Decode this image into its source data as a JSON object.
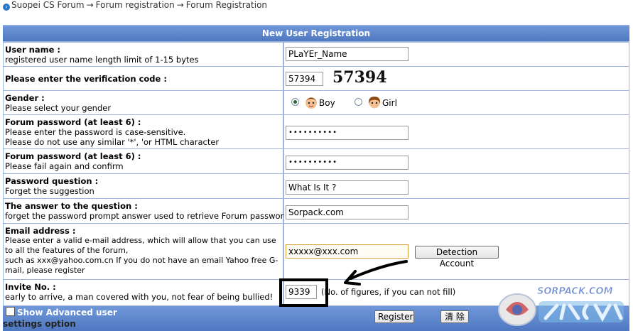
{
  "breadcrumb": {
    "items": [
      "Suopei CS Forum",
      "Forum registration",
      "Forum Registration"
    ],
    "separator": "→"
  },
  "form": {
    "title": "New User Registration",
    "username": {
      "label": "User name :",
      "hint": "registered user name length limit of 1-15 bytes",
      "value": "PLaYEr_Name"
    },
    "verify": {
      "label": "Please enter the verification code :",
      "value": "57394",
      "captcha_text": "57394"
    },
    "gender": {
      "label": "Gender :",
      "hint": "Please select your gender",
      "options": [
        "Boy",
        "Girl"
      ],
      "selected": "Boy"
    },
    "password": {
      "label": "Forum password (at least 6) :",
      "hint1": "Please enter the password is case-sensitive.",
      "hint2": "Please do not use any similar '*', 'or HTML character",
      "value": "••••••••••"
    },
    "password_confirm": {
      "label": "Forum password (at least 6) :",
      "hint": "Please fail again and confirm",
      "value": "••••••••••"
    },
    "question": {
      "label": "Password question :",
      "hint": "Forget the suggestion",
      "value": "What Is It ?"
    },
    "answer": {
      "label": "The answer to the question :",
      "hint": "forget the password prompt answer used to retrieve Forum password",
      "value": "Sorpack.com"
    },
    "email": {
      "label": "Email address :",
      "hint1": "Please enter a valid e-mail address, which will allow that you can use",
      "hint2": "to all the features of the forum,",
      "hint3": "such as xxx@yahoo.com.cn If you do not have an email Yahoo free G-",
      "hint4": "mail, please register",
      "value": "xxxxx@xxx.com",
      "detect_button": "Detection Account"
    },
    "invite": {
      "label": "Invite No. :",
      "hint": "early to arrive, a man covered with you, not fear of being bullied!",
      "value": "9339",
      "note": "(No. of figures, if you can not fill)"
    },
    "footer": {
      "advanced_label": "Show Advanced user",
      "advanced_sub": "settings option",
      "register_button": "Register",
      "clear_button": "清 除"
    }
  },
  "watermark": {
    "text": "SORPACK.COM"
  },
  "colors": {
    "header_blue": "#5a82c9",
    "grid_blue": "#9eb5dc",
    "annotation": "#000000"
  }
}
